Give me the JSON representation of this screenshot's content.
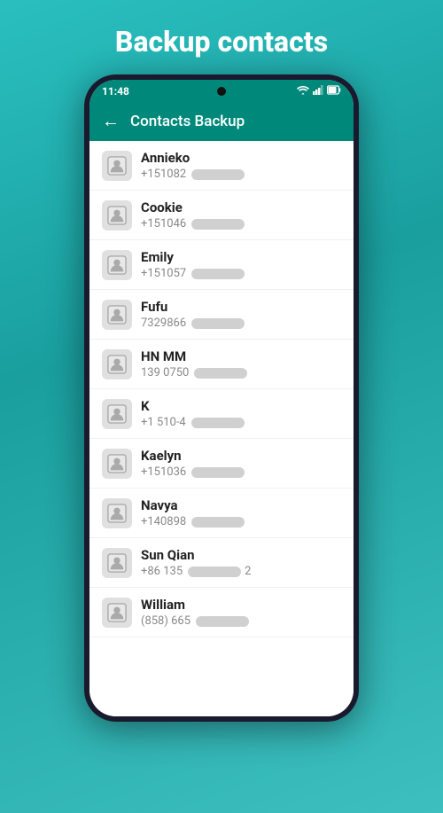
{
  "page": {
    "title": "Backup contacts",
    "background_color": "#2abfbf"
  },
  "status_bar": {
    "time": "11:48",
    "icons": [
      "wifi",
      "signal",
      "battery"
    ]
  },
  "app_bar": {
    "back_label": "←",
    "title": "Contacts Backup"
  },
  "contacts": [
    {
      "name": "Annieko",
      "phone_prefix": "+151082",
      "has_blur": true
    },
    {
      "name": "Cookie",
      "phone_prefix": "+151046",
      "has_blur": true
    },
    {
      "name": "Emily",
      "phone_prefix": "+151057",
      "has_blur": true
    },
    {
      "name": "Fufu",
      "phone_prefix": "7329866",
      "has_blur": true
    },
    {
      "name": "HN MM",
      "phone_prefix": "139 0750",
      "has_blur": true
    },
    {
      "name": "K",
      "phone_prefix": "+1 510-4",
      "has_blur": true
    },
    {
      "name": "Kaelyn",
      "phone_prefix": "+151036",
      "has_blur": true
    },
    {
      "name": "Navya",
      "phone_prefix": "+140898",
      "has_blur": true
    },
    {
      "name": "Sun Qian",
      "phone_prefix": "+86 135",
      "has_blur": true,
      "phone_suffix": "2"
    },
    {
      "name": "William",
      "phone_prefix": "(858) 665",
      "has_blur": true
    }
  ]
}
